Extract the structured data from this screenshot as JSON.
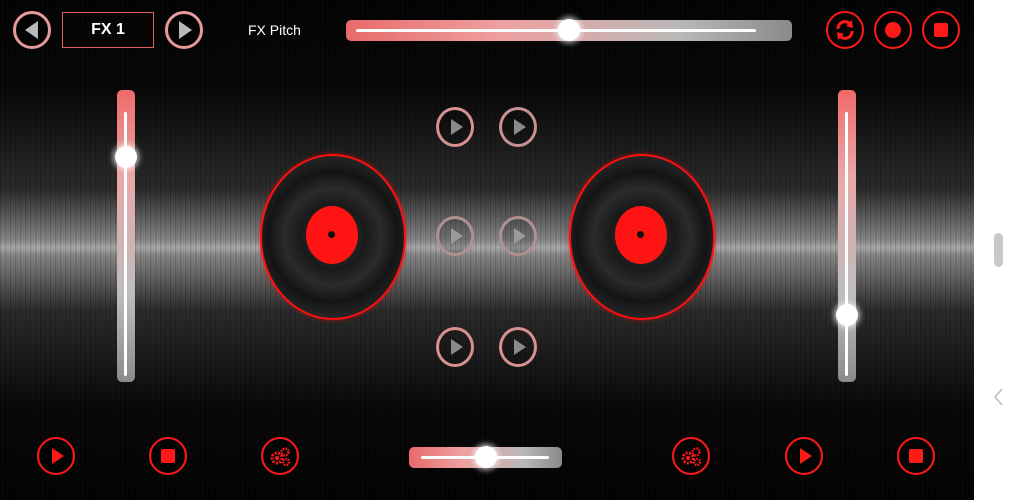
{
  "header": {
    "fx_name": "FX 1",
    "fx_pitch_label": "FX Pitch",
    "fx_pitch_value": 0.5
  },
  "left_deck": {
    "volume_value": 0.82
  },
  "right_deck": {
    "volume_value": 0.18
  },
  "crossfader_value": 0.5,
  "icons": {
    "prev": "triangle-left-icon",
    "next": "triangle-right-icon",
    "sync": "refresh-icon",
    "record": "record-icon",
    "stop": "stop-icon",
    "play": "play-icon",
    "settings": "gears-icon"
  },
  "colors": {
    "accent": "#ff1a1a",
    "knob": "#ffffff",
    "button_outline": "#e79a9a"
  }
}
